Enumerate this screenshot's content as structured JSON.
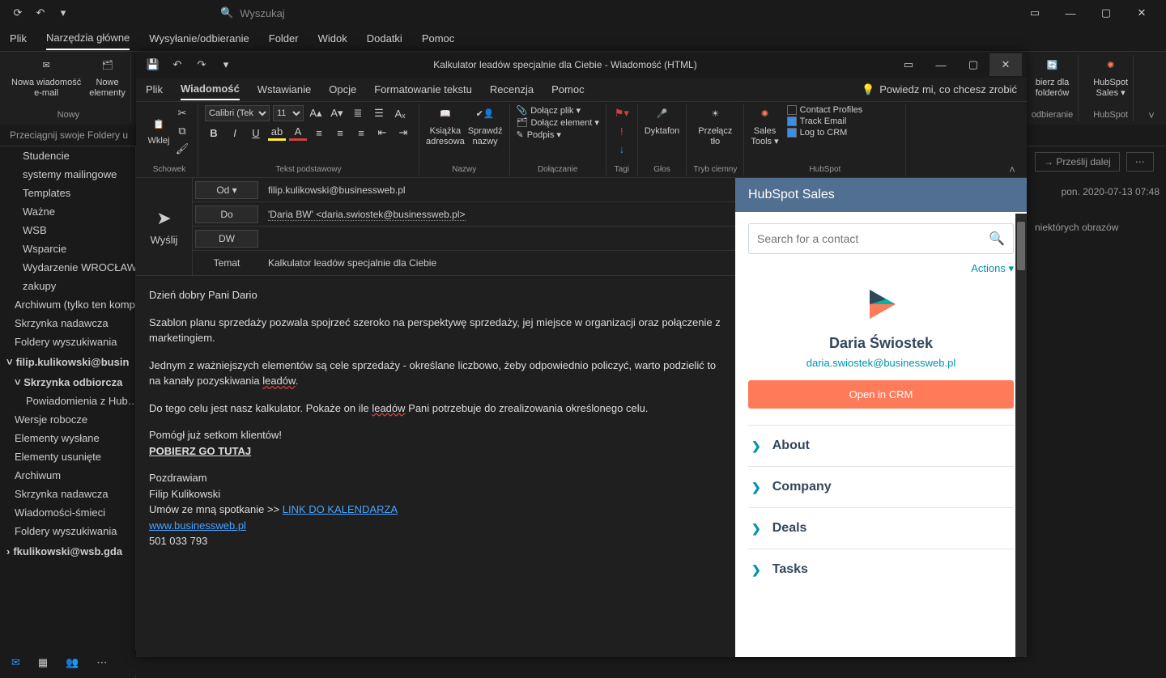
{
  "outlook": {
    "search_placeholder": "Wyszukaj",
    "tabs": [
      "Plik",
      "Narzędzia główne",
      "Wysyłanie/odbieranie",
      "Folder",
      "Widok",
      "Dodatki",
      "Pomoc"
    ],
    "ribbon": {
      "new_mail": "Nowa wiadomość\ne-mail",
      "new_items": "Nowe\nelementy",
      "group_new": "Nowy",
      "right1": "bierz dla\nfolderów",
      "right1_grp": "odbieranie",
      "right2": "HubSpot\nSales ▾",
      "right2_grp": "HubSpot"
    },
    "folder_hint": "Przeciągnij swoje Foldery u",
    "folders_top": [
      "Studencie",
      "systemy mailingowe",
      "Templates",
      "Ważne",
      "WSB",
      "Wsparcie",
      "Wydarzenie WROCŁAW",
      "zakupy"
    ],
    "folders_mid": [
      "Archiwum (tylko ten komp",
      "Skrzynka nadawcza",
      "Foldery wyszukiwania"
    ],
    "account1": "filip.kulikowski@busin",
    "account1_sub": [
      "Skrzynka odbiorcza",
      "Powiadomienia z Hub…",
      "Wersje robocze",
      "Elementy wysłane",
      "Elementy usunięte",
      "Archiwum",
      "Skrzynka nadawcza",
      "Wiadomości-śmieci",
      "Foldery wyszukiwania"
    ],
    "account2": "fkulikowski@wsb.gda",
    "right_pane": {
      "forward": "Prześlij dalej",
      "date": "pon. 2020-07-13 07:48",
      "note": "niektórych obrazów"
    }
  },
  "msg": {
    "title": "Kalkulator leadów specjalnie dla Ciebie - Wiadomość (HTML)",
    "tabs": [
      "Plik",
      "Wiadomość",
      "Wstawianie",
      "Opcje",
      "Formatowanie tekstu",
      "Recenzja",
      "Pomoc"
    ],
    "tellme": "Powiedz mi, co chcesz zrobić",
    "ribbon": {
      "paste": "Wklej",
      "clipboard": "Schowek",
      "font_name": "Calibri (Tek",
      "font_size": "11",
      "basic_text": "Tekst podstawowy",
      "addressbook": "Książka\nadresowa",
      "checknames": "Sprawdź\nnazwy",
      "names": "Nazwy",
      "attach_file": "Dołącz plik ▾",
      "attach_item": "Dołącz element ▾",
      "signature": "Podpis ▾",
      "include": "Dołączanie",
      "tags": "Tagi",
      "dictate": "Dyktafon",
      "voice": "Głos",
      "darkmode": "Przełącz\ntło",
      "dark_grp": "Tryb ciemny",
      "sales_tools": "Sales\nTools ▾",
      "hs_profiles": "Contact Profiles",
      "hs_track": "Track Email",
      "hs_log": "Log to CRM",
      "hs_grp": "HubSpot"
    },
    "send": "Wyślij",
    "hdr": {
      "from_lbl": "Od ▾",
      "from": "filip.kulikowski@businessweb.pl",
      "to_lbl": "Do",
      "to": "'Daria BW' <daria.swiostek@businessweb.pl>",
      "cc_lbl": "DW",
      "subj_lbl": "Temat",
      "subj": "Kalkulator leadów specjalnie dla Ciebie"
    },
    "body": {
      "greet": "Dzień dobry Pani Dario",
      "p1a": "Szablon planu sprzedaży pozwala spojrzeć szeroko na perspektywę sprzedaży, jej miejsce w organizacji oraz połączenie z marketingiem.",
      "p2a": "Jednym z ważniejszych elementów są cele sprzedaży - określane liczbowo, żeby odpowiednio policzyć, warto podzielić to na kanały pozyskiwania ",
      "p2b": "leadów",
      "p3a": "Do tego celu jest nasz kalkulator. Pokaże on ile ",
      "p3b": "leadów",
      "p3c": " Pani potrzebuje do zrealizowania określonego celu.",
      "p4": "Pomógł już setkom klientów!",
      "dl": "POBIERZ GO TUTAJ",
      "sig1": "Pozdrawiam",
      "sig2": "Filip Kulikowski",
      "sig3a": "Umów ze mną spotkanie >> ",
      "sig3b": "LINK DO KALENDARZA",
      "sig4": "www.businessweb.pl",
      "sig5": "501 033 793"
    }
  },
  "hubspot": {
    "title": "HubSpot Sales",
    "search_ph": "Search for a contact",
    "actions": "Actions ▾",
    "contact_name": "Daria Świostek",
    "contact_email": "daria.swiostek@businessweb.pl",
    "open_crm": "Open in CRM",
    "sections": [
      "About",
      "Company",
      "Deals",
      "Tasks"
    ]
  }
}
